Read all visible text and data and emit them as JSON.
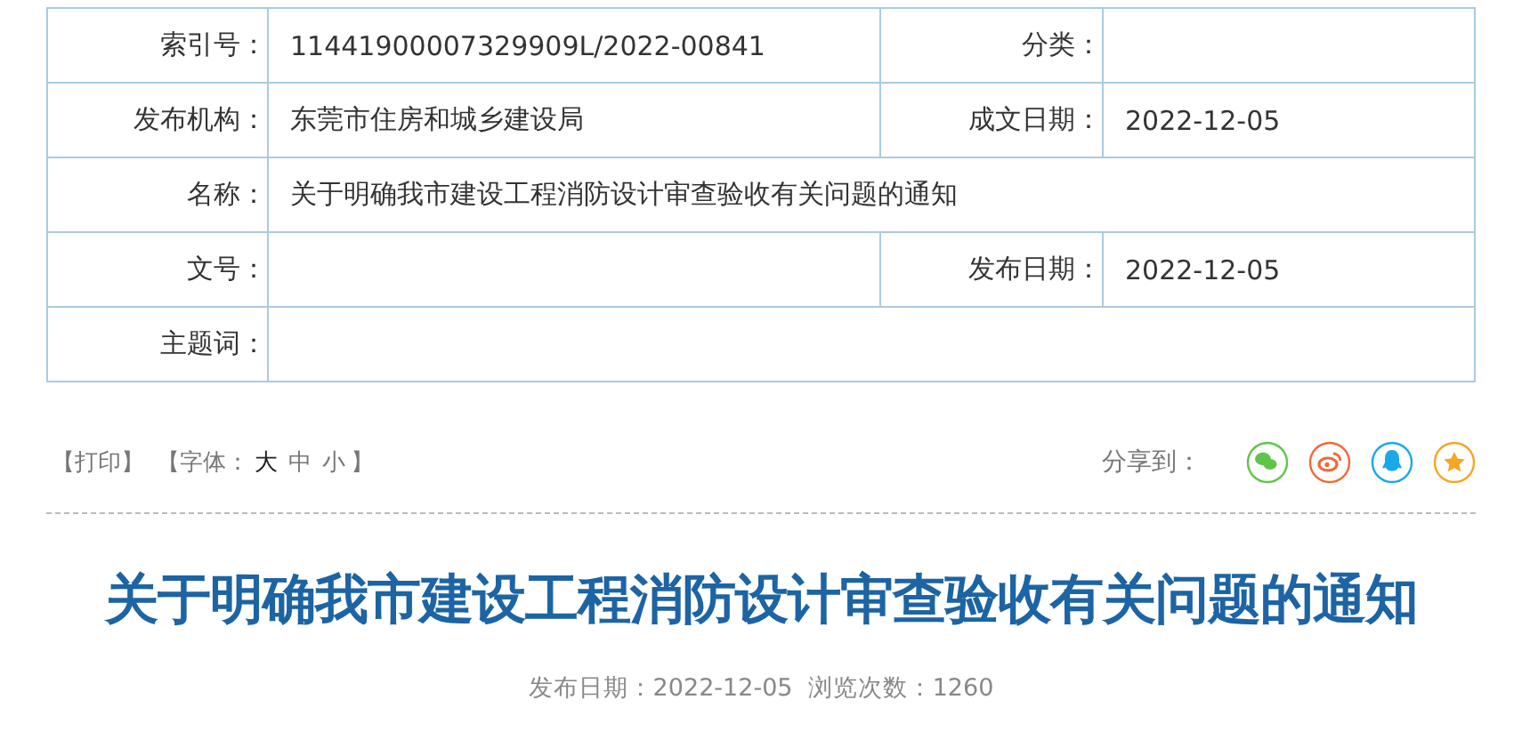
{
  "info_table": {
    "rows": [
      {
        "cells": [
          {
            "label": "索引号：",
            "value": "11441900007329909L/2022-00841"
          },
          {
            "label": "分类："
          }
        ]
      },
      {
        "cells": [
          {
            "label": "发布机构：",
            "value": "东莞市住房和城乡建设局"
          },
          {
            "label": "成文日期：",
            "value": "2022-12-05"
          }
        ]
      },
      {
        "cells": [
          {
            "label": "名称：",
            "value": "关于明确我市建设工程消防设计审查验收有关问题的通知"
          }
        ]
      },
      {
        "cells": [
          {
            "label": "文号："
          },
          {
            "label": "发布日期：",
            "value": "2022-12-05"
          }
        ]
      },
      {
        "cells": [
          {
            "label": "主题词："
          }
        ]
      }
    ]
  },
  "toolbar": {
    "print": "【打印】",
    "font_label": "【字体：",
    "font_sizes": [
      {
        "label": "大",
        "selected": true
      },
      {
        "label": "中",
        "selected": false
      },
      {
        "label": "小",
        "selected": false
      }
    ],
    "font_close": "】",
    "share_label": "分享到：",
    "share": [
      {
        "kind": "wechat",
        "color": "#5fc54a"
      },
      {
        "kind": "weibo",
        "color": "#f0693a"
      },
      {
        "kind": "qq",
        "color": "#1aa8e8"
      },
      {
        "kind": "favorite",
        "color": "#f5a623"
      }
    ]
  },
  "article": {
    "title": "关于明确我市建设工程消防设计审查验收有关问题的通知",
    "meta": "发布日期：2022-12-05  浏览次数：1260"
  }
}
